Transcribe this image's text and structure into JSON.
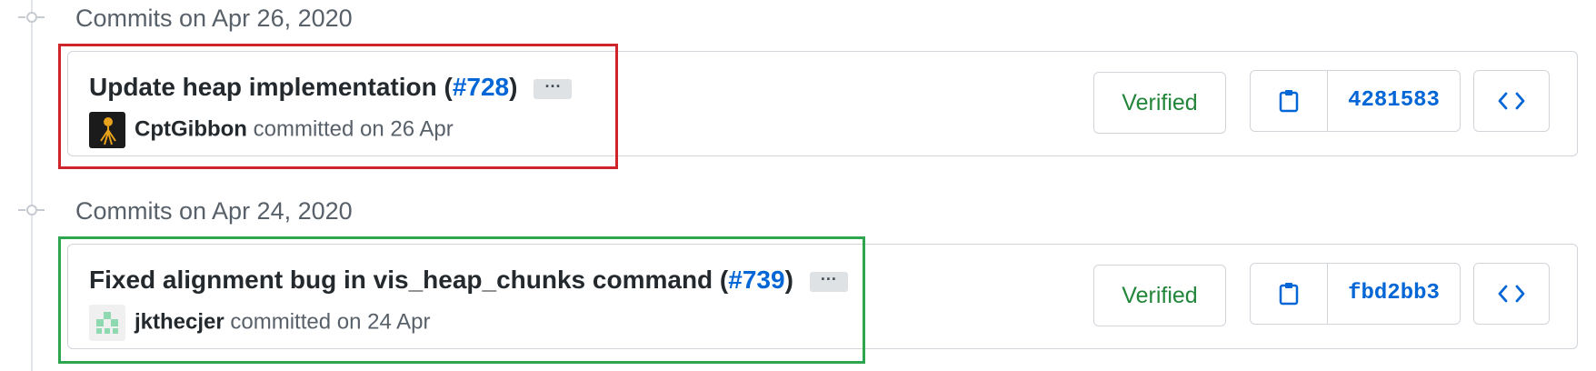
{
  "colors": {
    "accent": "#0366d6",
    "verified": "#22863a",
    "highlight_first": "#d0242b",
    "highlight_second": "#2da64f"
  },
  "groups": [
    {
      "date_heading": "Commits on Apr 26, 2020",
      "commit": {
        "title_prefix": "Update heap implementation (",
        "pr_number": "#728",
        "title_suffix": ")",
        "ellipsis": "···",
        "author": "CptGibbon",
        "byline": " committed on 26 Apr",
        "avatar_icon": "orange-creature-avatar",
        "verified": "Verified",
        "sha": "4281583",
        "copy_icon": "clipboard-icon",
        "browse_icon": "code-icon"
      }
    },
    {
      "date_heading": "Commits on Apr 24, 2020",
      "commit": {
        "title_prefix": "Fixed alignment bug in vis_heap_chunks command (",
        "pr_number": "#739",
        "title_suffix": ")",
        "ellipsis": "···",
        "author": "jkthecjer",
        "byline": " committed on 24 Apr",
        "avatar_icon": "green-identicon-avatar",
        "verified": "Verified",
        "sha": "fbd2bb3",
        "copy_icon": "clipboard-icon",
        "browse_icon": "code-icon"
      }
    }
  ]
}
